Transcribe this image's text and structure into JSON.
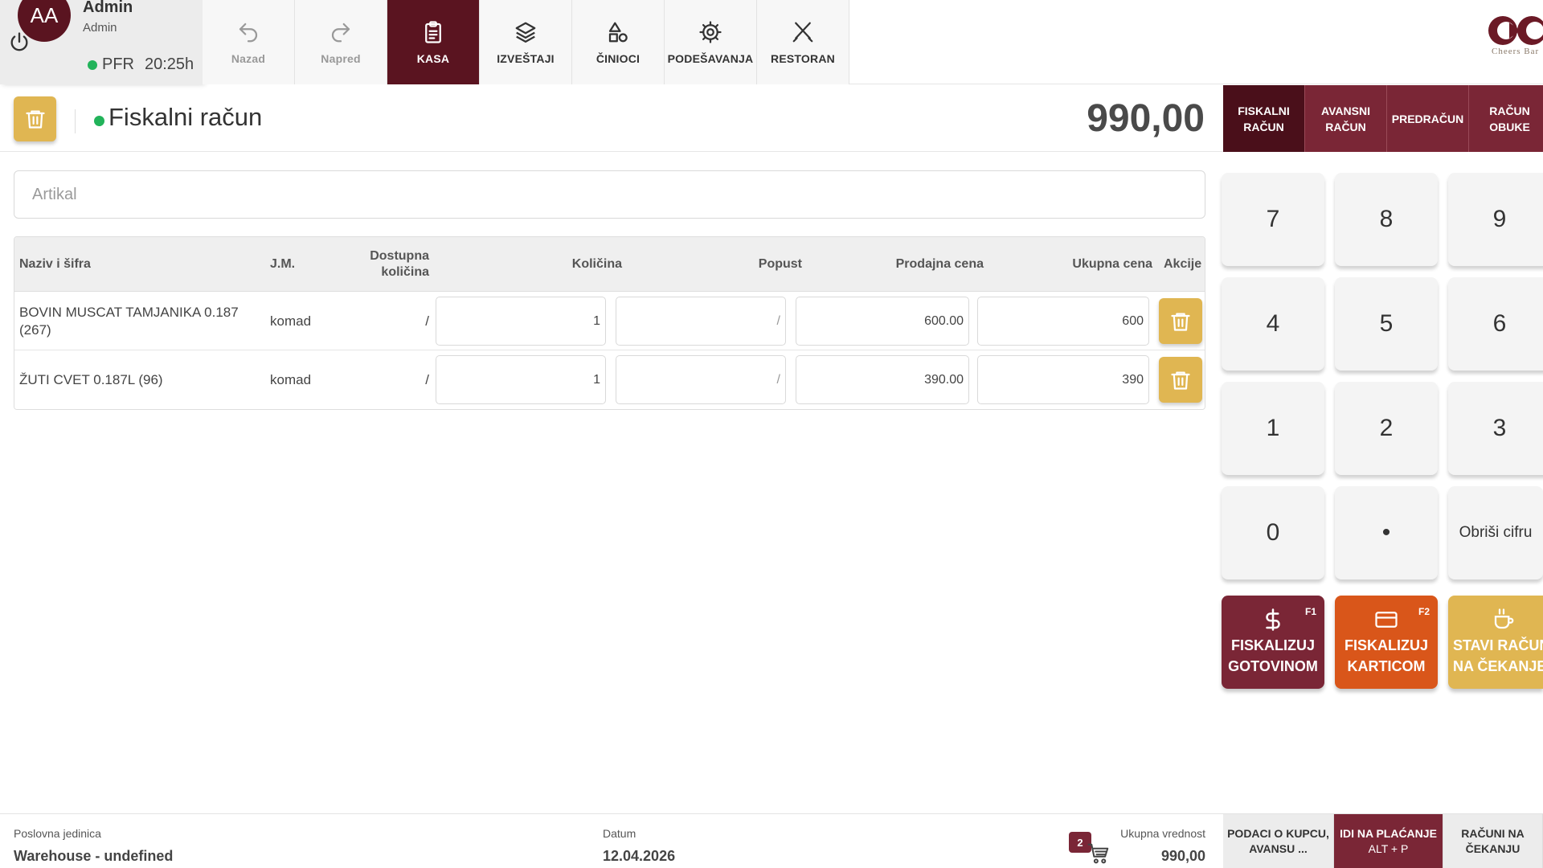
{
  "user": {
    "initials": "AA",
    "name": "Admin",
    "role": "Admin",
    "status_label": "PFR",
    "session_time": "20:25h"
  },
  "nav": {
    "items": [
      {
        "label": "Nazad",
        "icon": "undo-icon"
      },
      {
        "label": "Napred",
        "icon": "redo-icon"
      },
      {
        "label": "KASA",
        "icon": "clipboard-icon"
      },
      {
        "label": "IZVEŠTAJI",
        "icon": "layers-icon"
      },
      {
        "label": "ČINIOCI",
        "icon": "shapes-icon"
      },
      {
        "label": "PODEŠAVANJA",
        "icon": "gear-icon"
      },
      {
        "label": "RESTORAN",
        "icon": "utensils-icon"
      }
    ],
    "active": "KASA"
  },
  "brand": {
    "logo_text": "Cheers Bar",
    "color": "#5a1420"
  },
  "header": {
    "title": "Fiskalni račun",
    "total": "990,00"
  },
  "receipt_types": [
    {
      "line1": "FISKALNI",
      "line2": "RAČUN"
    },
    {
      "line1": "AVANSNI",
      "line2": "RAČUN"
    },
    {
      "line1": "PREDRAČUN",
      "line2": ""
    },
    {
      "line1": "RAČUN",
      "line2": "OBUKE"
    }
  ],
  "article_input": {
    "placeholder": "Artikal",
    "value": ""
  },
  "table": {
    "headers": {
      "name": "Naziv i šifra",
      "unit": "J.M.",
      "available_line1": "Dostupna",
      "available_line2": "količina",
      "quantity": "Količina",
      "discount": "Popust",
      "price": "Prodajna cena",
      "total": "Ukupna cena",
      "actions": "Akcije"
    },
    "rows": [
      {
        "name_line1": "BOVIN MUSCAT TAMJANIKA 0.187",
        "name_line2": "(267)",
        "unit": "komad",
        "available": "/",
        "quantity": "1",
        "discount": "/",
        "price": "600.00",
        "total": "600"
      },
      {
        "name_line1": "ŽUTI CVET 0.187L (96)",
        "name_line2": "",
        "unit": "komad",
        "available": "/",
        "quantity": "1",
        "discount": "/",
        "price": "390.00",
        "total": "390"
      }
    ]
  },
  "keypad": {
    "keys": [
      "7",
      "8",
      "9",
      "4",
      "5",
      "6",
      "1",
      "2",
      "3",
      "0",
      "•",
      "Obriši cifru"
    ],
    "actions": [
      {
        "line1": "FISKALIZUJ",
        "line2": "GOTOVINOM",
        "fkey": "F1",
        "icon": "dollar-icon",
        "color": "#7a2636"
      },
      {
        "line1": "FISKALIZUJ",
        "line2": "KARTICOM",
        "fkey": "F2",
        "icon": "credit-card-icon",
        "color": "#d9561a"
      },
      {
        "line1": "STAVI RAČUN",
        "line2": "NA ČEKANJE",
        "fkey": "",
        "icon": "coffee-icon",
        "color": "#e0b652"
      }
    ]
  },
  "footer": {
    "unit_label": "Poslovna jedinica",
    "unit_value": "Warehouse - undefined",
    "date_label": "Datum",
    "date_value": "12.04.2026",
    "cart_count": "2",
    "total_label": "Ukupna vrednost",
    "total_value": "990,00",
    "actions": [
      {
        "line1": "PODACI O KUPCU,",
        "line2": "AVANSU ..."
      },
      {
        "line1": "IDI NA PLAĆANJE",
        "line2": "ALT + P"
      },
      {
        "line1": "RAČUNI NA",
        "line2": "ČEKANJU"
      }
    ]
  }
}
